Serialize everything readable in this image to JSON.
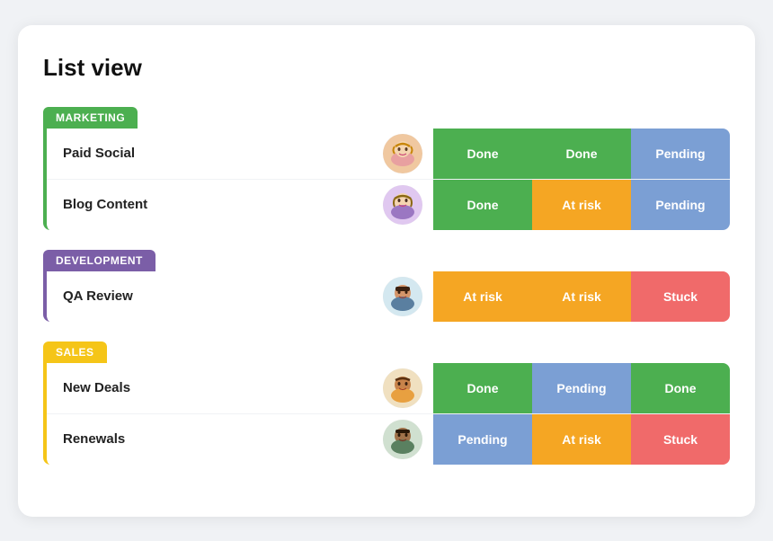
{
  "page": {
    "title": "List view"
  },
  "groups": [
    {
      "id": "marketing",
      "label": "MARKETING",
      "theme": "marketing",
      "rows": [
        {
          "id": "paid-social",
          "label": "Paid Social",
          "avatar": "female1",
          "statuses": [
            "Done",
            "Done",
            "Pending"
          ]
        },
        {
          "id": "blog-content",
          "label": "Blog Content",
          "avatar": "female2",
          "statuses": [
            "Done",
            "At risk",
            "Pending"
          ]
        }
      ]
    },
    {
      "id": "development",
      "label": "DEVELOPMENT",
      "theme": "development",
      "rows": [
        {
          "id": "qa-review",
          "label": "QA Review",
          "avatar": "male1",
          "statuses": [
            "At risk",
            "At risk",
            "Stuck"
          ]
        }
      ]
    },
    {
      "id": "sales",
      "label": "SALES",
      "theme": "sales",
      "rows": [
        {
          "id": "new-deals",
          "label": "New Deals",
          "avatar": "male2",
          "statuses": [
            "Done",
            "Pending",
            "Done"
          ]
        },
        {
          "id": "renewals",
          "label": "Renewals",
          "avatar": "male3",
          "statuses": [
            "Pending",
            "At risk",
            "Stuck"
          ]
        }
      ]
    }
  ],
  "status_classes": {
    "Done": "status-done",
    "Pending": "status-pending",
    "At risk": "status-at-risk",
    "Stuck": "status-stuck"
  }
}
